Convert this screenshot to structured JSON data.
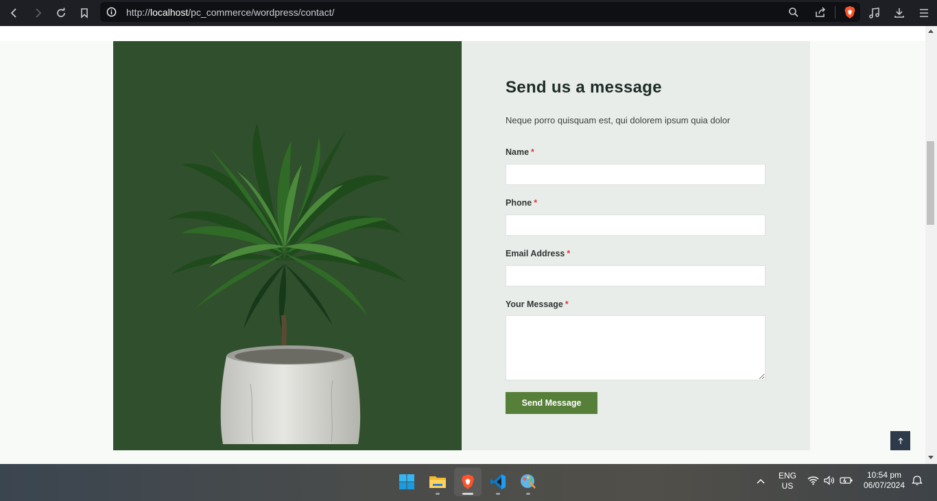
{
  "browser": {
    "url_prefix": "http://",
    "url_host": "localhost",
    "url_path": "/pc_commerce/wordpress/contact/"
  },
  "contact_form": {
    "title": "Send us a message",
    "subtitle": "Neque porro quisquam est, qui dolorem ipsum quia dolor",
    "fields": [
      {
        "label": "Name",
        "required_mark": "*",
        "value": ""
      },
      {
        "label": "Phone",
        "required_mark": "*",
        "value": ""
      },
      {
        "label": "Email Address",
        "required_mark": "*",
        "value": ""
      },
      {
        "label": "Your Message",
        "required_mark": "*",
        "value": ""
      }
    ],
    "submit_label": "Send Message"
  },
  "taskbar": {
    "language": "ENG",
    "region": "US",
    "time": "10:54 pm",
    "date": "06/07/2024"
  },
  "colors": {
    "image_panel_bg": "#304f2c",
    "form_panel_bg": "#e9edea",
    "button_bg": "#567f39",
    "required_mark": "#d93b3b"
  },
  "icons": [
    "back-icon",
    "forward-icon",
    "reload-icon",
    "bookmark-icon",
    "info-icon",
    "zoom-icon",
    "share-icon",
    "brave-shield-icon",
    "media-icon",
    "download-icon",
    "menu-icon",
    "arrow-up-icon",
    "windows-start-icon",
    "file-explorer-icon",
    "brave-browser-icon",
    "vscode-icon",
    "paint-icon",
    "tray-chevron-icon",
    "wifi-icon",
    "volume-icon",
    "battery-icon",
    "notification-icon"
  ]
}
